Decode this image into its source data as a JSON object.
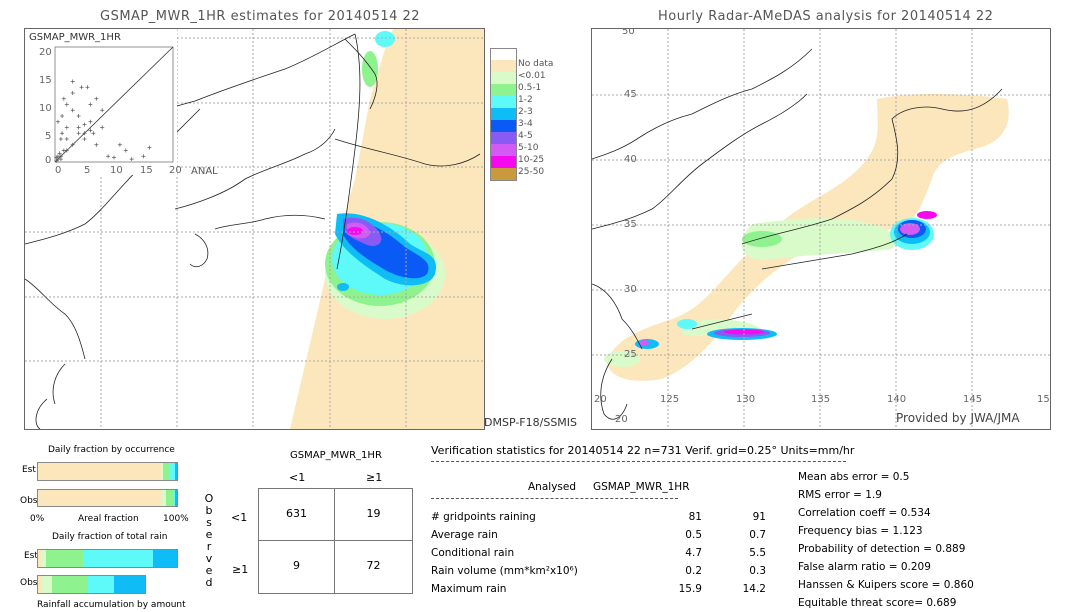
{
  "left_panel": {
    "title": "GSMAP_MWR_1HR estimates for 20140514 22",
    "scatter": {
      "ylabel": "GSMAP_MWR_1HR",
      "xlabel": "ANAL",
      "y_ticks": [
        "20",
        "15",
        "10",
        "5",
        "0"
      ],
      "x_ticks": [
        "0",
        "5",
        "10",
        "15",
        "20"
      ]
    },
    "satellite_label": "DMSP-F18/SSMIS"
  },
  "right_panel": {
    "title": "Hourly Radar-AMeDAS analysis for 20140514 22",
    "lat_labels": [
      "45",
      "40",
      "35",
      "30",
      "25",
      "20"
    ],
    "lon_labels": [
      "125",
      "130",
      "135",
      "140",
      "145",
      "15"
    ],
    "corner_label": "20",
    "credit": "Provided by JWA/JMA"
  },
  "legend": {
    "items": [
      {
        "label": "",
        "color": "#ffffff"
      },
      {
        "label": "No data",
        "color": "#fce7bd"
      },
      {
        "label": "<0.01",
        "color": "#d9fbc9"
      },
      {
        "label": "0.5-1",
        "color": "#8ef28e"
      },
      {
        "label": "1-2",
        "color": "#5ef9f9"
      },
      {
        "label": "2-3",
        "color": "#0fbcf5"
      },
      {
        "label": "3-4",
        "color": "#0a5af5"
      },
      {
        "label": "4-5",
        "color": "#8a5af5"
      },
      {
        "label": "5-10",
        "color": "#d35af5"
      },
      {
        "label": "10-25",
        "color": "#f50af0"
      },
      {
        "label": "25-50",
        "color": "#c89a3c"
      }
    ]
  },
  "occurrence": {
    "title": "Daily fraction by occurrence",
    "est_label": "Est",
    "obs_label": "Obs",
    "axis_left": "0%",
    "axis_mid": "Areal fraction",
    "axis_right": "100%",
    "est_segments": [
      {
        "color": "#fce7bd",
        "fraction": 0.885
      },
      {
        "color": "#d9fbc9",
        "fraction": 0.012
      },
      {
        "color": "#8ef28e",
        "fraction": 0.045
      },
      {
        "color": "#5ef9f9",
        "fraction": 0.045
      },
      {
        "color": "#0fbcf5",
        "fraction": 0.013
      }
    ],
    "obs_segments": [
      {
        "color": "#fce7bd",
        "fraction": 0.89
      },
      {
        "color": "#d9fbc9",
        "fraction": 0.03
      },
      {
        "color": "#8ef28e",
        "fraction": 0.055
      },
      {
        "color": "#5ef9f9",
        "fraction": 0.012
      },
      {
        "color": "#0fbcf5",
        "fraction": 0.013
      }
    ]
  },
  "total_rain": {
    "title": "Daily fraction of total rain",
    "est_label": "Est",
    "obs_label": "Obs",
    "footer": "Rainfall accumulation by amount",
    "est_segments": [
      {
        "color": "#fce7bd",
        "fraction": 0.02
      },
      {
        "color": "#d9fbc9",
        "fraction": 0.035
      },
      {
        "color": "#8ef28e",
        "fraction": 0.27
      },
      {
        "color": "#5ef9f9",
        "fraction": 0.5
      },
      {
        "color": "#0fbcf5",
        "fraction": 0.175
      }
    ],
    "obs_scale": 0.77,
    "obs_segments": [
      {
        "color": "#fce7bd",
        "fraction": 0.04
      },
      {
        "color": "#d9fbc9",
        "fraction": 0.09
      },
      {
        "color": "#8ef28e",
        "fraction": 0.34
      },
      {
        "color": "#5ef9f9",
        "fraction": 0.24
      },
      {
        "color": "#0fbcf5",
        "fraction": 0.29
      }
    ]
  },
  "contingency": {
    "header": "GSMAP_MWR_1HR",
    "col_labels": [
      "<1",
      "≥1"
    ],
    "row_labels": [
      "<1",
      "≥1"
    ],
    "side_label": [
      "O",
      "b",
      "s",
      "e",
      "r",
      "v",
      "e",
      "d"
    ],
    "cells": [
      [
        "631",
        "19"
      ],
      [
        "9",
        "72"
      ]
    ]
  },
  "verification": {
    "header": "Verification statistics for 20140514 22   n=731   Verif. grid=0.25°   Units=mm/hr",
    "col_analysed": "Analysed",
    "col_gsmap": "GSMAP_MWR_1HR",
    "rows": [
      {
        "label": "# gridpoints raining",
        "analysed": "81",
        "gsmap": "91"
      },
      {
        "label": "Average rain",
        "analysed": "0.5",
        "gsmap": "0.7"
      },
      {
        "label": "Conditional rain",
        "analysed": "4.7",
        "gsmap": "5.5"
      },
      {
        "label": "Rain volume (mm*km²x10⁶)",
        "analysed": "0.2",
        "gsmap": "0.3"
      },
      {
        "label": "Maximum rain",
        "analysed": "15.9",
        "gsmap": "14.2"
      }
    ],
    "scores": [
      "Mean abs error = 0.5",
      "RMS error = 1.9",
      "Correlation coeff = 0.534",
      "Frequency bias = 1.123",
      "Probability of detection = 0.889",
      "False alarm ratio = 0.209",
      "Hanssen & Kuipers score = 0.860",
      "Equitable threat score= 0.689"
    ]
  }
}
